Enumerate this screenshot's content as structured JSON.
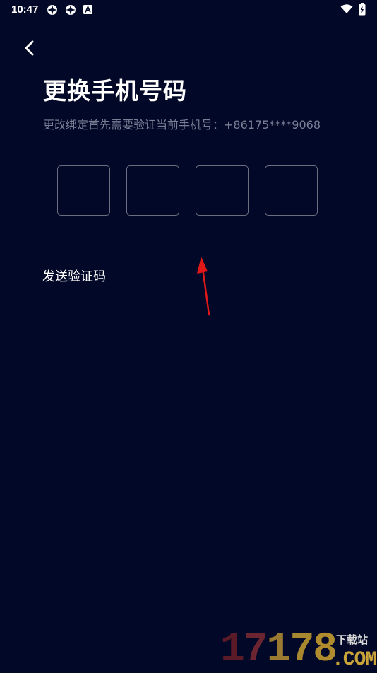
{
  "status_bar": {
    "time": "10:47",
    "icons": [
      "app-notification-icon",
      "app-notification-icon",
      "a-notification-icon",
      "wifi-icon",
      "battery-charging-icon"
    ]
  },
  "header": {
    "back_icon": "chevron-left-icon",
    "title": "更换手机号码",
    "subtitle": "更改绑定首先需要验证当前手机号：+86175****9068"
  },
  "code_input": {
    "length": 4,
    "values": [
      "",
      "",
      "",
      ""
    ]
  },
  "send_code": {
    "label": "发送验证码"
  },
  "watermark": {
    "digits": "17178",
    "label": "下载站",
    "domain": ".COM"
  },
  "colors": {
    "background": "#020827",
    "text_primary": "#ffffff",
    "text_secondary": "#7a7f95",
    "box_border": "#6b6e7e",
    "annotation_arrow": "#e01818"
  }
}
